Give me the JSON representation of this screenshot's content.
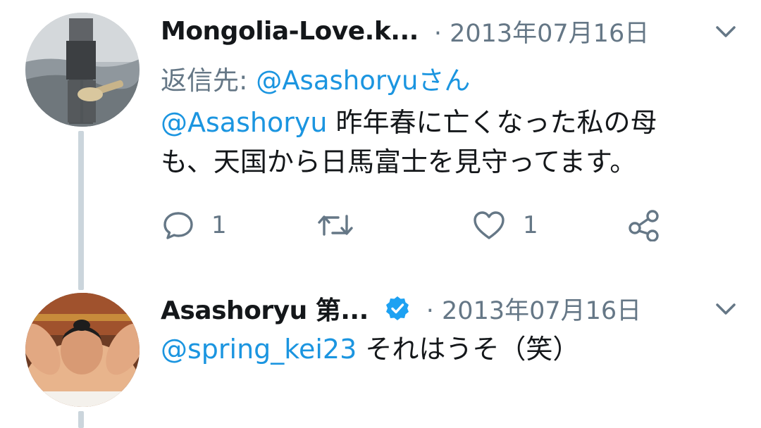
{
  "tweets": [
    {
      "display_name": "Mongolia-Love.k...",
      "meta": "· 2013年07月16日",
      "reply_prefix": "返信先: ",
      "reply_target": "@Asashoryuさん",
      "mention": "@Asashoryu",
      "text_line1": " 昨年春に亡くなった私の母",
      "text_line2": "も、天国から日馬富士を見守ってます。",
      "reply_count": "1",
      "like_count": "1"
    },
    {
      "display_name": "Asashoryu 第...",
      "verified": true,
      "meta": "· 2013年07月16日",
      "mention": "@spring_kei23",
      "text": " それはうそ（笑）"
    }
  ],
  "icons": {
    "reply": "reply-icon",
    "retweet": "retweet-icon",
    "like": "heart-icon",
    "share": "share-icon",
    "caret": "chevron-down-icon",
    "verified": "verified-badge-icon"
  },
  "colors": {
    "link": "#1b95e0",
    "secondary_text": "#657786",
    "thread_line": "#cbd5dc",
    "verified": "#1da1f2"
  }
}
